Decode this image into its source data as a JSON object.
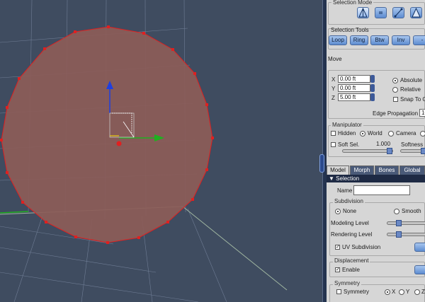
{
  "selection_mode": {
    "title": "Selection Mode",
    "modes": [
      "vertex-mode-icon",
      "edge-mode-icon",
      "polygon-mode-icon",
      "object-mode-icon"
    ]
  },
  "selection_tools": {
    "title": "Selection Tools",
    "buttons": [
      "Loop",
      "Ring",
      "Btw",
      "Inv",
      "-"
    ]
  },
  "move": {
    "title": "Move",
    "x_label": "X",
    "x_value": "0.00 ft",
    "y_label": "Y",
    "y_value": "0.00 ft",
    "z_label": "Z",
    "z_value": "5.00 ft",
    "absolute_label": "Absolute",
    "relative_label": "Relative",
    "snap_label": "Snap To G",
    "edge_propagation_label": "Edge Propagation",
    "edge_propagation_value": "10"
  },
  "manipulator": {
    "title": "Manipulator",
    "hidden_label": "Hidden",
    "world_label": "World",
    "camera_label": "Camera",
    "soft_sel_label": "Soft Sel.",
    "soft_sel_value": "1.000",
    "softness_label": "Softness"
  },
  "tabs": [
    "Model",
    "Morph",
    "Bones",
    "Global"
  ],
  "selection_header": "Selection",
  "name": {
    "label": "Name",
    "value": ""
  },
  "subdivision": {
    "title": "Subdivision",
    "none_label": "None",
    "smooth_label": "Smooth",
    "modeling_label": "Modeling Level",
    "rendering_label": "Rendering Level",
    "uv_label": "UV Subdivision"
  },
  "displacement": {
    "title": "Displacement",
    "enable_label": "Enable"
  },
  "symmetry": {
    "title": "Symmetry",
    "symmetry_label": "Symmetry",
    "x_label": "X",
    "y_label": "Y",
    "z_label": "Z"
  },
  "colors": {
    "viewport_bg": "#3f4c60",
    "disc_fill": "#8c5c58",
    "edge_color": "#e02020",
    "grid_color": "#7f8da6",
    "ground_line": "#9fb5a0",
    "axis_y": "#1f3fe0",
    "axis_x": "#20b020"
  }
}
